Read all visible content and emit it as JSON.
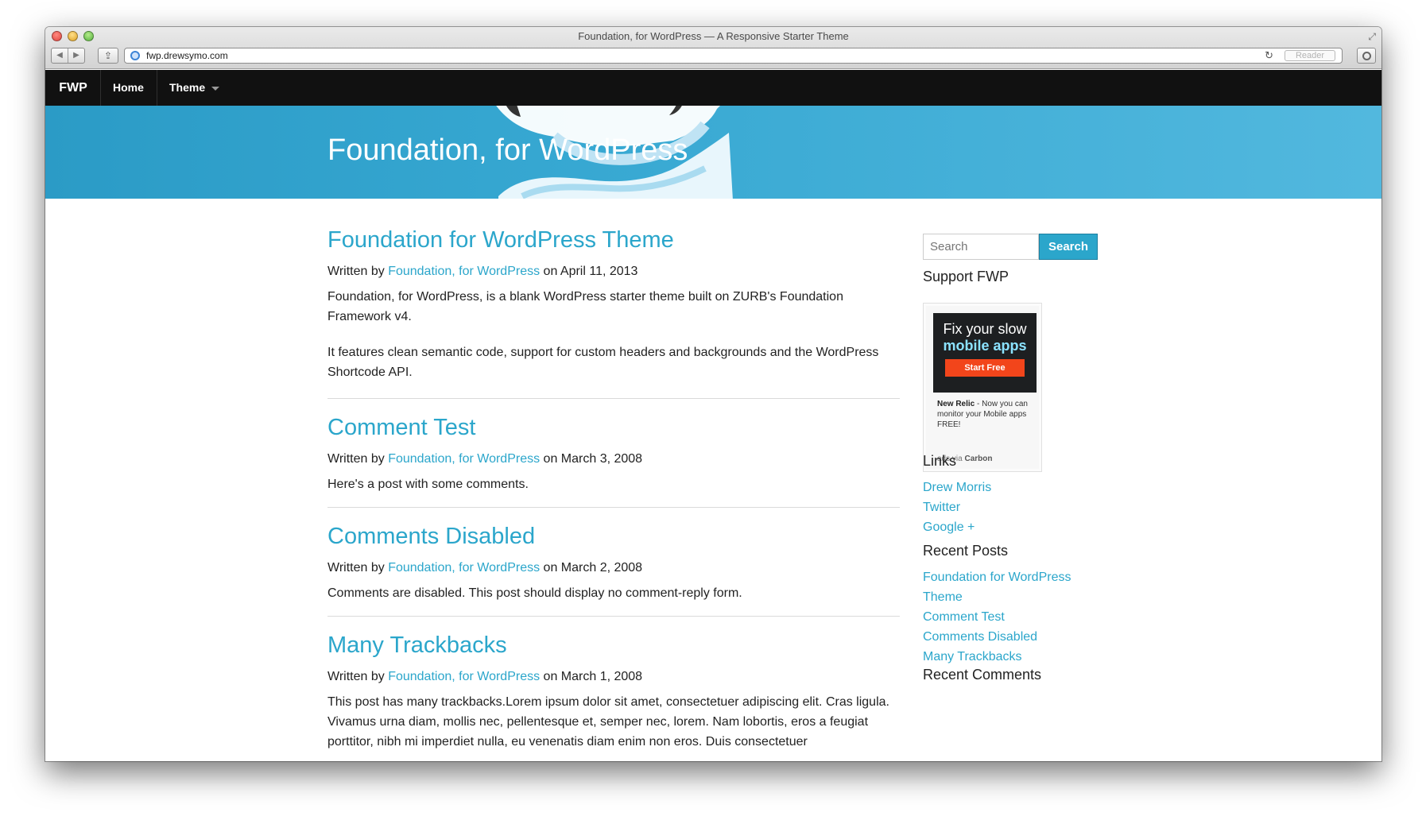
{
  "browser": {
    "window_title": "Foundation, for WordPress — A Responsive Starter Theme",
    "url": "fwp.drewsymo.com",
    "reader_label": "Reader"
  },
  "nav": {
    "logo": "FWP",
    "home": "Home",
    "theme": "Theme"
  },
  "header": {
    "site_title": "Foundation, for WordPress"
  },
  "posts": [
    {
      "title": "Foundation for WordPress Theme",
      "written_by": "Written by",
      "author": "Foundation, for WordPress",
      "on_date": "on April 11, 2013",
      "paragraphs": [
        "Foundation, for WordPress, is a blank WordPress starter theme built on ZURB's Foundation Framework v4.",
        "It features clean semantic code, support for custom headers and backgrounds and the WordPress Shortcode API."
      ]
    },
    {
      "title": "Comment Test",
      "written_by": "Written by",
      "author": "Foundation, for WordPress",
      "on_date": "on March 3, 2008",
      "paragraphs": [
        "Here's a post with some comments."
      ]
    },
    {
      "title": "Comments Disabled",
      "written_by": "Written by",
      "author": "Foundation, for WordPress",
      "on_date": "on March 2, 2008",
      "paragraphs": [
        "Comments are disabled. This post should display no comment-reply form."
      ]
    },
    {
      "title": "Many Trackbacks",
      "written_by": "Written by",
      "author": "Foundation, for WordPress",
      "on_date": "on March 1, 2008",
      "paragraphs": [
        "This post has many trackbacks.Lorem ipsum dolor sit amet, consectetuer adipiscing elit. Cras ligula. Vivamus urna diam, mollis nec, pellentesque et, semper nec, lorem. Nam lobortis, eros a feugiat porttitor, nibh mi imperdiet nulla, eu venenatis diam enim non eros. Duis consectetuer"
      ]
    }
  ],
  "sidebar": {
    "search_placeholder": "Search",
    "search_button": "Search",
    "support_title": "Support FWP",
    "ad": {
      "line1": "Fix your slow",
      "line2": "mobile apps",
      "cta": "Start Free",
      "brand": "New Relic",
      "text": " - Now you can monitor your Mobile apps FREE!",
      "via": "ads via ",
      "via_brand": "Carbon"
    },
    "links_title": "Links",
    "links": [
      "Drew Morris",
      "Twitter",
      "Google +"
    ],
    "recent_posts_title": "Recent Posts",
    "recent_posts": [
      "Foundation for WordPress",
      "Theme",
      "Comment Test",
      "Comments Disabled",
      "Many Trackbacks"
    ],
    "recent_comments_title": "Recent Comments"
  },
  "colors": {
    "accent": "#2ba6cb",
    "topbar": "#111111",
    "banner": "#37a8d2"
  }
}
